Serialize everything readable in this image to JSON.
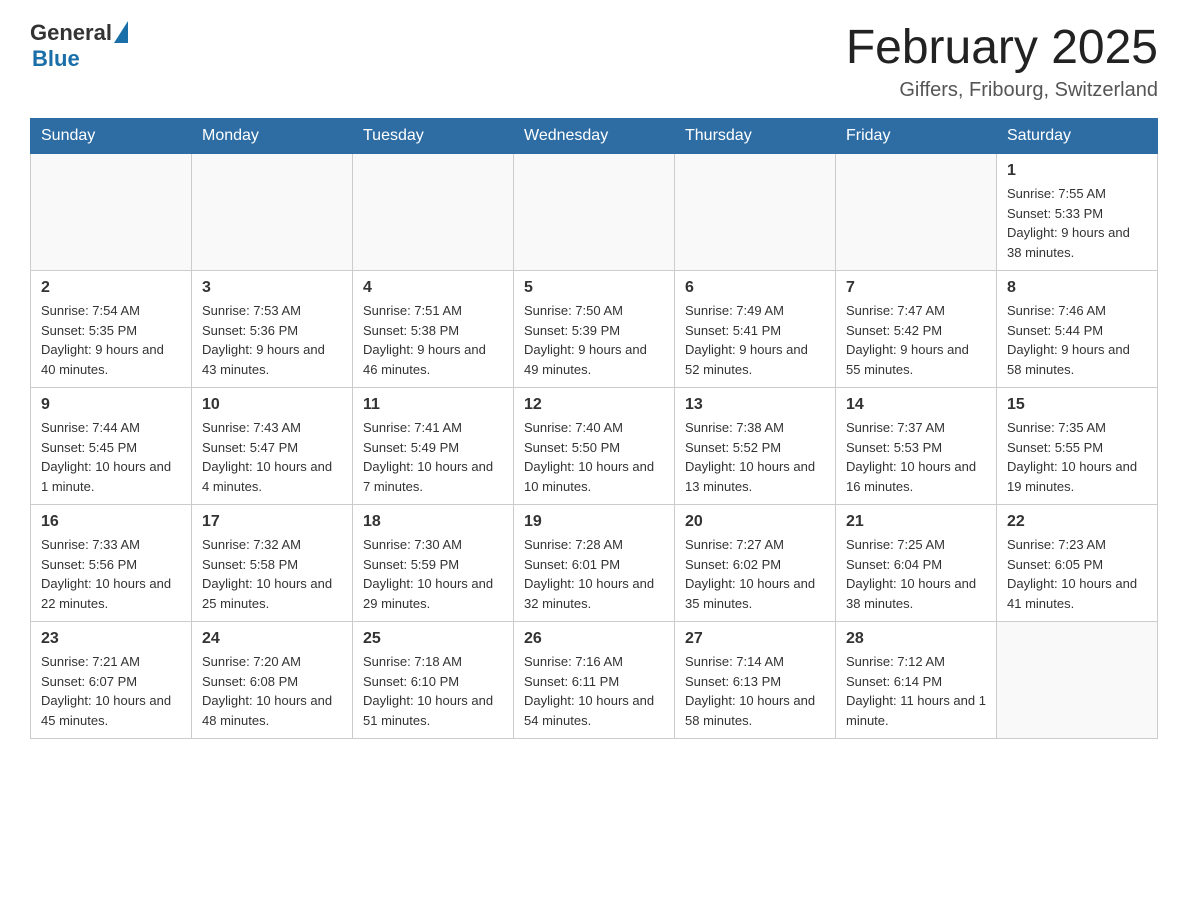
{
  "header": {
    "logo_general": "General",
    "logo_blue": "Blue",
    "title": "February 2025",
    "subtitle": "Giffers, Fribourg, Switzerland"
  },
  "days_of_week": [
    "Sunday",
    "Monday",
    "Tuesday",
    "Wednesday",
    "Thursday",
    "Friday",
    "Saturday"
  ],
  "weeks": [
    [
      {
        "day": "",
        "info": ""
      },
      {
        "day": "",
        "info": ""
      },
      {
        "day": "",
        "info": ""
      },
      {
        "day": "",
        "info": ""
      },
      {
        "day": "",
        "info": ""
      },
      {
        "day": "",
        "info": ""
      },
      {
        "day": "1",
        "info": "Sunrise: 7:55 AM\nSunset: 5:33 PM\nDaylight: 9 hours and 38 minutes."
      }
    ],
    [
      {
        "day": "2",
        "info": "Sunrise: 7:54 AM\nSunset: 5:35 PM\nDaylight: 9 hours and 40 minutes."
      },
      {
        "day": "3",
        "info": "Sunrise: 7:53 AM\nSunset: 5:36 PM\nDaylight: 9 hours and 43 minutes."
      },
      {
        "day": "4",
        "info": "Sunrise: 7:51 AM\nSunset: 5:38 PM\nDaylight: 9 hours and 46 minutes."
      },
      {
        "day": "5",
        "info": "Sunrise: 7:50 AM\nSunset: 5:39 PM\nDaylight: 9 hours and 49 minutes."
      },
      {
        "day": "6",
        "info": "Sunrise: 7:49 AM\nSunset: 5:41 PM\nDaylight: 9 hours and 52 minutes."
      },
      {
        "day": "7",
        "info": "Sunrise: 7:47 AM\nSunset: 5:42 PM\nDaylight: 9 hours and 55 minutes."
      },
      {
        "day": "8",
        "info": "Sunrise: 7:46 AM\nSunset: 5:44 PM\nDaylight: 9 hours and 58 minutes."
      }
    ],
    [
      {
        "day": "9",
        "info": "Sunrise: 7:44 AM\nSunset: 5:45 PM\nDaylight: 10 hours and 1 minute."
      },
      {
        "day": "10",
        "info": "Sunrise: 7:43 AM\nSunset: 5:47 PM\nDaylight: 10 hours and 4 minutes."
      },
      {
        "day": "11",
        "info": "Sunrise: 7:41 AM\nSunset: 5:49 PM\nDaylight: 10 hours and 7 minutes."
      },
      {
        "day": "12",
        "info": "Sunrise: 7:40 AM\nSunset: 5:50 PM\nDaylight: 10 hours and 10 minutes."
      },
      {
        "day": "13",
        "info": "Sunrise: 7:38 AM\nSunset: 5:52 PM\nDaylight: 10 hours and 13 minutes."
      },
      {
        "day": "14",
        "info": "Sunrise: 7:37 AM\nSunset: 5:53 PM\nDaylight: 10 hours and 16 minutes."
      },
      {
        "day": "15",
        "info": "Sunrise: 7:35 AM\nSunset: 5:55 PM\nDaylight: 10 hours and 19 minutes."
      }
    ],
    [
      {
        "day": "16",
        "info": "Sunrise: 7:33 AM\nSunset: 5:56 PM\nDaylight: 10 hours and 22 minutes."
      },
      {
        "day": "17",
        "info": "Sunrise: 7:32 AM\nSunset: 5:58 PM\nDaylight: 10 hours and 25 minutes."
      },
      {
        "day": "18",
        "info": "Sunrise: 7:30 AM\nSunset: 5:59 PM\nDaylight: 10 hours and 29 minutes."
      },
      {
        "day": "19",
        "info": "Sunrise: 7:28 AM\nSunset: 6:01 PM\nDaylight: 10 hours and 32 minutes."
      },
      {
        "day": "20",
        "info": "Sunrise: 7:27 AM\nSunset: 6:02 PM\nDaylight: 10 hours and 35 minutes."
      },
      {
        "day": "21",
        "info": "Sunrise: 7:25 AM\nSunset: 6:04 PM\nDaylight: 10 hours and 38 minutes."
      },
      {
        "day": "22",
        "info": "Sunrise: 7:23 AM\nSunset: 6:05 PM\nDaylight: 10 hours and 41 minutes."
      }
    ],
    [
      {
        "day": "23",
        "info": "Sunrise: 7:21 AM\nSunset: 6:07 PM\nDaylight: 10 hours and 45 minutes."
      },
      {
        "day": "24",
        "info": "Sunrise: 7:20 AM\nSunset: 6:08 PM\nDaylight: 10 hours and 48 minutes."
      },
      {
        "day": "25",
        "info": "Sunrise: 7:18 AM\nSunset: 6:10 PM\nDaylight: 10 hours and 51 minutes."
      },
      {
        "day": "26",
        "info": "Sunrise: 7:16 AM\nSunset: 6:11 PM\nDaylight: 10 hours and 54 minutes."
      },
      {
        "day": "27",
        "info": "Sunrise: 7:14 AM\nSunset: 6:13 PM\nDaylight: 10 hours and 58 minutes."
      },
      {
        "day": "28",
        "info": "Sunrise: 7:12 AM\nSunset: 6:14 PM\nDaylight: 11 hours and 1 minute."
      },
      {
        "day": "",
        "info": ""
      }
    ]
  ]
}
